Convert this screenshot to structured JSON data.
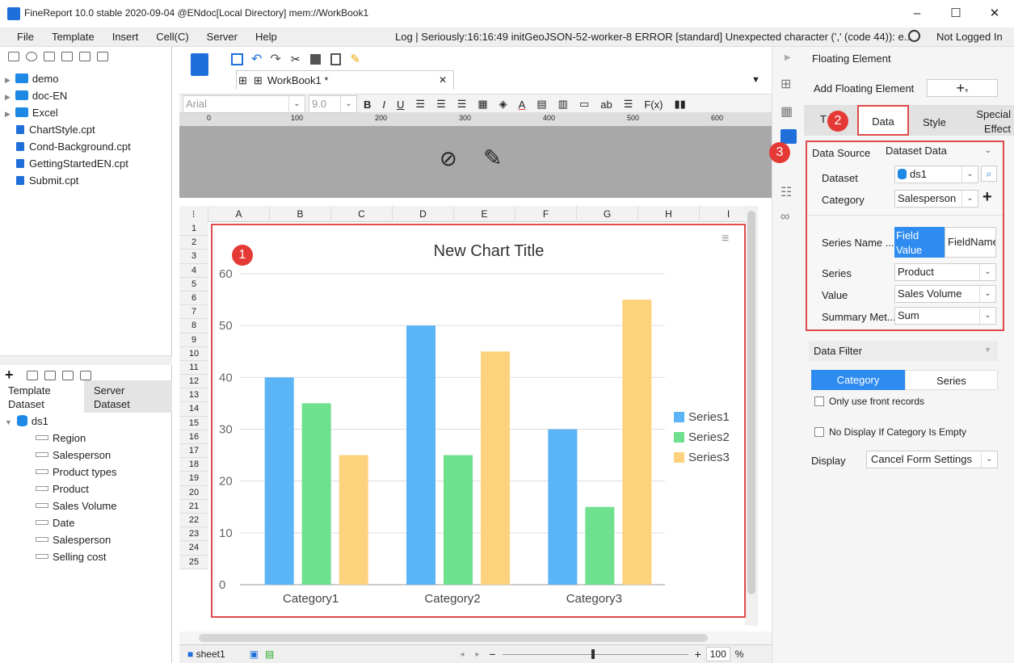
{
  "window": {
    "title": "FineReport 10.0 stable 2020-09-04 @ENdoc[Local Directory]    mem://WorkBook1",
    "min": "–",
    "max": "☐",
    "close": "✕"
  },
  "menu": {
    "items": [
      "File",
      "Template",
      "Insert",
      "Cell(C)",
      "Server",
      "Help"
    ],
    "log": "Log | Seriously:16:16:49 initGeoJSON-52-worker-8 ERROR [standard] Unexpected character (',' (code 44)): e...",
    "login": "Not Logged In"
  },
  "file_tree": [
    {
      "type": "folder",
      "label": "demo"
    },
    {
      "type": "folder",
      "label": "doc-EN"
    },
    {
      "type": "folder",
      "label": "Excel"
    },
    {
      "type": "file",
      "label": "ChartStyle.cpt"
    },
    {
      "type": "file",
      "label": "Cond-Background.cpt"
    },
    {
      "type": "file",
      "label": "GettingStartedEN.cpt"
    },
    {
      "type": "file",
      "label": "Submit.cpt"
    }
  ],
  "dataset_panel": {
    "tab_template": "Template Dataset",
    "tab_server": "Server Dataset",
    "dataset": "ds1",
    "fields": [
      "Region",
      "Salesperson",
      "Product types",
      "Product",
      "Sales Volume",
      "Date",
      "Salesperson",
      "Selling cost"
    ]
  },
  "editor": {
    "tab": "WorkBook1 *",
    "font": "Arial",
    "size": "9.0",
    "ruler": [
      "0",
      "100",
      "200",
      "300",
      "400",
      "500",
      "600"
    ],
    "columns": [
      "A",
      "B",
      "C",
      "D",
      "E",
      "F",
      "G",
      "H",
      "I"
    ],
    "rows": [
      "1",
      "2",
      "3",
      "4",
      "5",
      "6",
      "7",
      "8",
      "9",
      "10",
      "11",
      "12",
      "13",
      "14",
      "15",
      "16",
      "17",
      "18",
      "19",
      "20",
      "21",
      "22",
      "23",
      "24",
      "25"
    ],
    "sheet": "sheet1",
    "zoom": "100",
    "zoom_unit": "%"
  },
  "chart_data": {
    "type": "bar",
    "title": "New Chart Title",
    "categories": [
      "Category1",
      "Category2",
      "Category3"
    ],
    "series": [
      {
        "name": "Series1",
        "values": [
          40,
          50,
          30
        ],
        "color": "#5ab4f5"
      },
      {
        "name": "Series2",
        "values": [
          35,
          25,
          15
        ],
        "color": "#6fe08d"
      },
      {
        "name": "Series3",
        "values": [
          25,
          45,
          55
        ],
        "color": "#fcd37c"
      }
    ],
    "ylim": [
      0,
      60
    ],
    "yticks": [
      "0",
      "10",
      "20",
      "30",
      "40",
      "50",
      "60"
    ],
    "legend": "right",
    "grid": true
  },
  "right_panel": {
    "header": "Floating Element",
    "add_label": "Add Floating Element",
    "add_btn": "+",
    "tabs": {
      "type": "T",
      "data": "Data",
      "style": "Style",
      "effect": "Special Effect"
    },
    "data_source_label": "Data Source",
    "data_source": "Dataset Data",
    "dataset_label": "Dataset",
    "dataset": "ds1",
    "category_label": "Category",
    "category": "Salesperson",
    "series_name_label": "Series Name ...",
    "series_name_opt1": "Field Value",
    "series_name_opt2": "FieldName",
    "series_label": "Series",
    "series": "Product",
    "value_label": "Value",
    "value": "Sales Volume",
    "summary_label": "Summary Met...",
    "summary": "Sum",
    "filter_label": "Data Filter",
    "filter_tab1": "Category",
    "filter_tab2": "Series",
    "only_front": "Only use front records",
    "no_display": "No Display If Category Is Empty",
    "display_label": "Display",
    "display": "Cancel Form Settings"
  },
  "badges": [
    "1",
    "2",
    "3"
  ]
}
